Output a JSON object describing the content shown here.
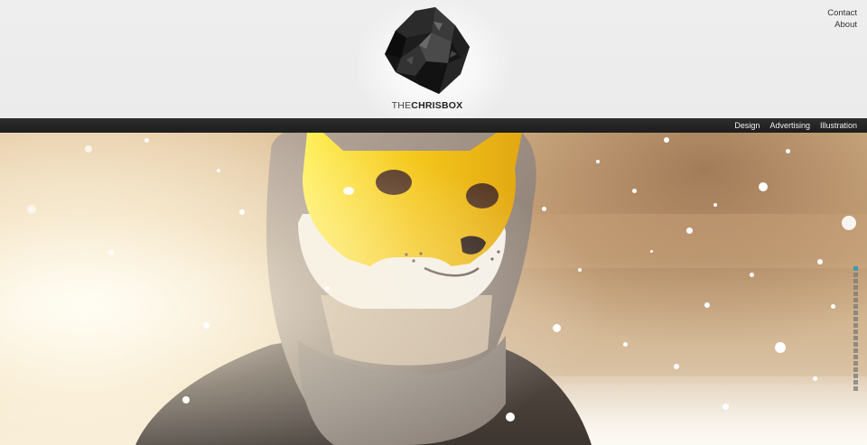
{
  "brand": {
    "name_light": "THE",
    "name_bold": "CHRISBOX"
  },
  "util_nav": [
    {
      "label": "Contact"
    },
    {
      "label": "About"
    }
  ],
  "main_nav": [
    {
      "label": "Design"
    },
    {
      "label": "Advertising"
    },
    {
      "label": "Illustration"
    }
  ],
  "hero": {
    "image": "fox-mask-person-in-hoodie-snowfall",
    "accent_color": "#3d9dab",
    "mask_color": "#f2c51d",
    "slide_count": 20,
    "active_slide": 1
  }
}
